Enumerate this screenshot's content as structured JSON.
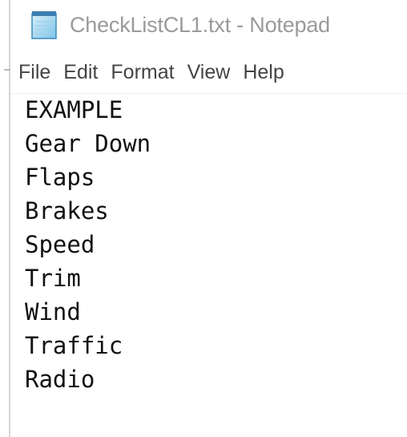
{
  "window": {
    "title": "CheckListCL1.txt - Notepad",
    "app_icon": "notepad-icon"
  },
  "menubar": {
    "items": [
      "File",
      "Edit",
      "Format",
      "View",
      "Help"
    ]
  },
  "editor": {
    "lines": [
      "EXAMPLE",
      "Gear Down",
      "Flaps",
      "Brakes",
      "Speed",
      "Trim",
      "Wind",
      "Traffic",
      "Radio"
    ]
  },
  "colors": {
    "title_text": "#9a9a9a",
    "menu_text": "#444444",
    "editor_text": "#111111",
    "background": "#ffffff"
  }
}
